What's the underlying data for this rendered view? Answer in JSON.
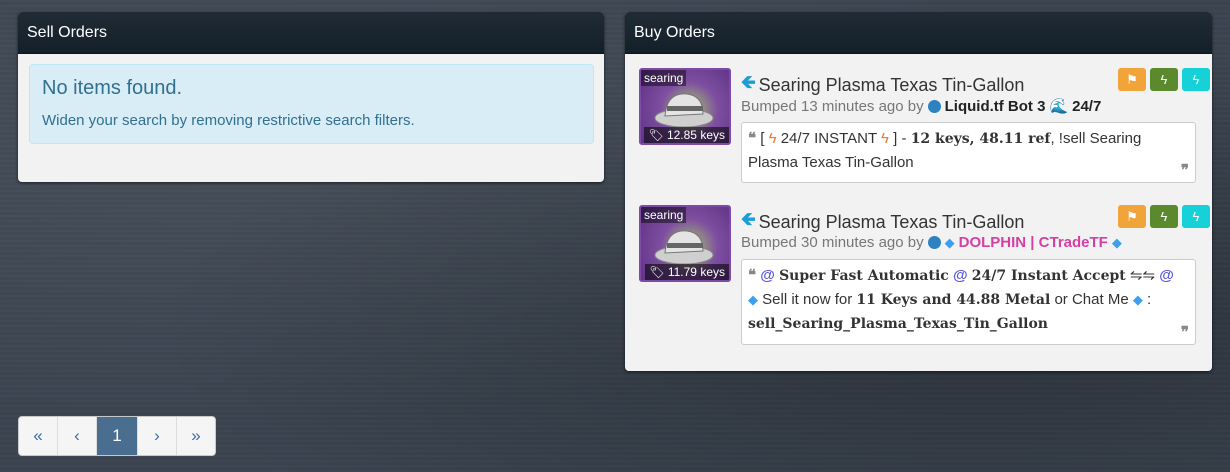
{
  "sell_orders": {
    "header": "Sell Orders",
    "empty_title": "No items found.",
    "empty_text": "Widen your search by removing restrictive search filters."
  },
  "buy_orders": {
    "header": "Buy Orders",
    "listings": [
      {
        "quality_tag": "searing",
        "price": "12.85 keys",
        "item_name": "Searing Plasma Texas Tin-Gallon",
        "bumped": "Bumped 13 minutes ago by",
        "user": "Liquid.tf Bot 3",
        "user_extra": "24/7",
        "message": {
          "open": "[",
          "instant": "24/7 INSTANT",
          "close": "] -",
          "price_bold": "12 keys, 48.11 ref",
          "rest": ", !sell Searing Plasma Texas Tin-Gallon"
        }
      },
      {
        "quality_tag": "searing",
        "price": "11.79 keys",
        "item_name": "Searing Plasma Texas Tin-Gallon",
        "bumped": "Bumped 30 minutes ago by",
        "user": "DOLPHIN | CTradeTF",
        "message": {
          "part1": "Super Fast Automatic",
          "part2": "24/7 Instant Accept",
          "arrows": "⇋⇋",
          "sell_text": "Sell it now for",
          "price_bold": "11 Keys and 44.88 Metal",
          "chat": "or Chat Me",
          "colon": ":",
          "command": "sell_Searing_Plasma_Texas_Tin_Gallon"
        }
      }
    ]
  },
  "pagination": {
    "first": "«",
    "prev": "‹",
    "current": "1",
    "next": "›",
    "last": "»"
  },
  "colors": {
    "header_bg": "#172430",
    "alert_bg": "#d9edf7",
    "flag_button": "#f0a43a",
    "bolt_green": "#5b8a2e",
    "bolt_cyan": "#17d1d9",
    "active_page": "#4a6e8f"
  },
  "icons": [
    "tag-icon",
    "arrow-left-icon",
    "flag-icon",
    "bolt-icon",
    "steam-dot-icon",
    "quote-open-icon",
    "quote-close-icon"
  ]
}
